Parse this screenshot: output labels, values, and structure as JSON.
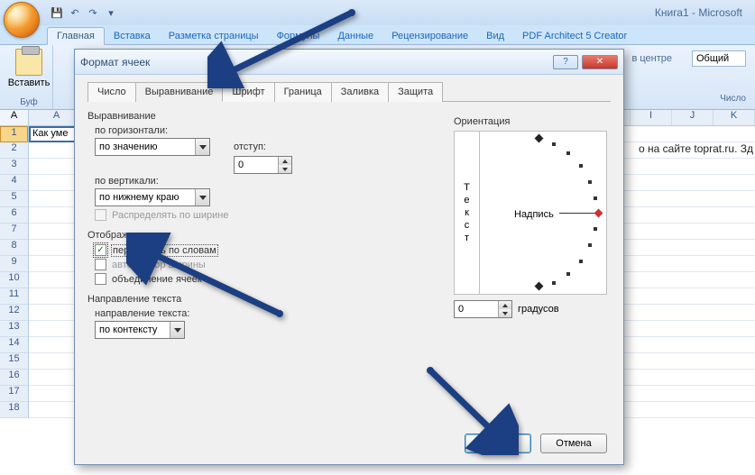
{
  "app": {
    "title": "Книга1 - Microsoft"
  },
  "qat": {
    "save": "save-icon",
    "undo": "undo-icon",
    "redo": "redo-icon"
  },
  "ribbon": {
    "tabs": [
      "Главная",
      "Вставка",
      "Разметка страницы",
      "Формулы",
      "Данные",
      "Рецензирование",
      "Вид",
      "PDF Architect 5 Creator"
    ],
    "active": 0,
    "paste_label": "Вставить",
    "clipboard_group": "Буф",
    "align_fragment": "в центре",
    "number_format": "Общий",
    "number_group": "Число"
  },
  "grid": {
    "namebox": "A",
    "right_headers": [
      "I",
      "J",
      "K"
    ],
    "row_count": 18,
    "cell_a1": "Как уме",
    "right_text": "о на сайте toprat.ru. Зд"
  },
  "dialog": {
    "title": "Формат ячеек",
    "help": "?",
    "close": "✕",
    "tabs": [
      "Число",
      "Выравнивание",
      "Шрифт",
      "Граница",
      "Заливка",
      "Защита"
    ],
    "active_tab": 1,
    "align_section": "Выравнивание",
    "h_label": "по горизонтали:",
    "h_value": "по значению",
    "indent_label": "отступ:",
    "indent_value": "0",
    "v_label": "по вертикали:",
    "v_value": "по нижнему краю",
    "justify": "Распределять по ширине",
    "display_section": "Отображение",
    "wrap": "переносить по словам",
    "wrap_checked": true,
    "autofit": "автоподбор ширины",
    "merge": "объединение ячеек",
    "direction_section": "Направление текста",
    "direction_label": "направление текста:",
    "direction_value": "по контексту",
    "orientation_label": "Ориентация",
    "orientation_vtext": "Т\nе\nк\nс\nт",
    "orientation_text": "Надпись",
    "degrees_value": "0",
    "degrees_label": "градусов",
    "ok": "ОК",
    "cancel": "Отмена"
  }
}
